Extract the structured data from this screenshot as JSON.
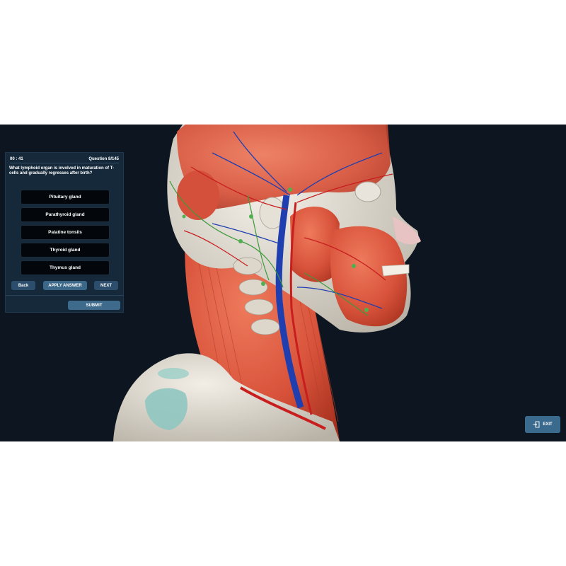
{
  "quiz": {
    "timer": "00 : 41",
    "question_counter": "Question 8/145",
    "question": "What lymphoid organ is involved in maturation of T-cells and gradually regresses after birth?",
    "answers": [
      "Pituitary gland",
      "Parathyroid gland",
      "Palatine tonsils",
      "Thyroid gland",
      "Thymus gland"
    ],
    "back_label": "Back",
    "apply_label": "APPLY ANSWER",
    "next_label": "NEXT",
    "submit_label": "SUBMIT"
  },
  "exit_label": "EXIT",
  "icons": {
    "exit": "exit-door-icon"
  },
  "colors": {
    "viewport_bg": "#0d1620",
    "panel_bg": "#16293a",
    "answer_bg": "#03070b",
    "button": "#2c4e6c",
    "muscle": "#d9553b",
    "bone": "#d8d3c8",
    "artery": "#c81e1e",
    "vein": "#1f3fb0",
    "lymph": "#3c9a3c",
    "cartilage": "#8fc7c0"
  }
}
